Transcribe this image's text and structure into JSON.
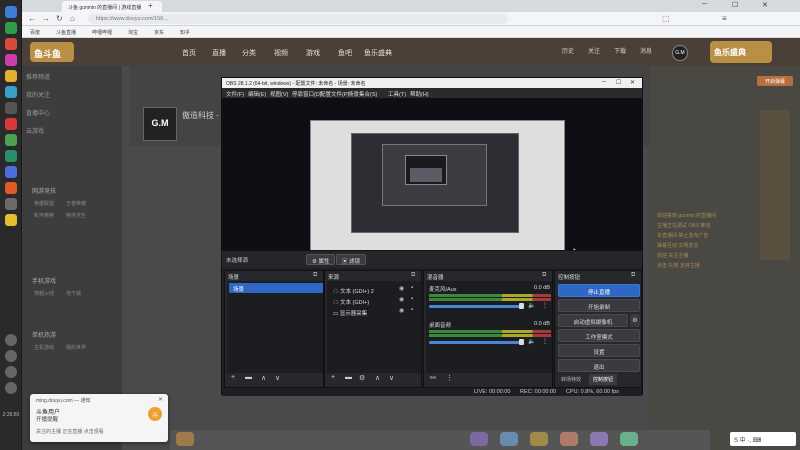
{
  "browser": {
    "tab_title": "斗鱼 gunmin 的直播间 | 游戏直播",
    "url": "https://www.douyu.com/156...",
    "new_tab": "+",
    "bookmarks": [
      "百度",
      "斗鱼直播",
      "哔哩哔哩",
      "淘宝",
      "京东",
      "知乎"
    ]
  },
  "site": {
    "logo_text": "鱼斗鱼",
    "nav": [
      "首页",
      "直播",
      "分类",
      "视频",
      "游戏",
      "鱼吧",
      "鱼乐盛典"
    ],
    "header_right": [
      "历史",
      "关注",
      "下载",
      "消息"
    ],
    "avatar_text": "G.M",
    "promo_text": "鱼乐盛典"
  },
  "sidebar": {
    "items": [
      "推荐频道",
      "我的关注",
      "直播中心",
      "云游戏"
    ],
    "sections": [
      "网游竞技",
      "手机游戏",
      "单机热游"
    ],
    "sub_items": [
      "英雄联盟",
      "王者荣耀",
      "和平精英",
      "绝地求生",
      "穿越火线",
      "地下城",
      "主机游戏",
      "我的世界"
    ]
  },
  "room": {
    "avatar_text": "G.M",
    "title": "傲造科技 - 直播间"
  },
  "chat": {
    "button": "开启弹幕",
    "lines": [
      "欢迎来到 gunmin 的直播间",
      "主播正在调试 OBS 推流",
      "本直播间 禁止发布广告",
      "弹幕互动 文明发言",
      "欢迎 关注主播",
      "点击 礼物 支持主播"
    ]
  },
  "obs": {
    "title": "OBS 28.1.2 (64-bit, windows) - 配置文件: 未命名 - 场景: 未命名",
    "menu": [
      "文件(F)",
      "编辑(E)",
      "视图(V)",
      "停靠窗口(D)",
      "配置文件(P)",
      "场景集合(S)",
      "工具(T)",
      "帮助(H)"
    ],
    "no_source": "未选择源",
    "properties_btn": "属性",
    "filters_btn": "滤镜",
    "scenes": {
      "title": "场景",
      "items": [
        "场景"
      ]
    },
    "sources": {
      "title": "来源",
      "items": [
        "文本 (GDI+) 2",
        "文本 (GDI+)",
        "显示器采集"
      ]
    },
    "mixer": {
      "title": "混音器",
      "channels": [
        {
          "name": "麦克风/Aux",
          "db": "0.0 dB"
        },
        {
          "name": "桌面音频",
          "db": "0.0 dB"
        }
      ]
    },
    "controls": {
      "title": "控制按钮",
      "buttons": [
        "停止直播",
        "开始录制",
        "启动虚拟摄像机",
        "工作室模式",
        "设置",
        "退出"
      ],
      "tabs": [
        "转场特效",
        "控制按钮"
      ]
    },
    "status": {
      "live": "LIVE: 00:00:00",
      "rec": "REC: 00:00:00",
      "cpu": "CPU: 0.8%, 60.00 fps"
    }
  },
  "notification": {
    "source": "ming.douyu.com — 通知",
    "title": "斗鱼用户",
    "body": "开播提醒",
    "message": "关注的主播 正在直播 点击观看",
    "avatar": "斗"
  },
  "taskbar": {
    "time": "2:26:50"
  },
  "ime": "S 中 ·, ⌨",
  "colors": {
    "accent": "#2f68c4",
    "brand": "#b98f45"
  }
}
